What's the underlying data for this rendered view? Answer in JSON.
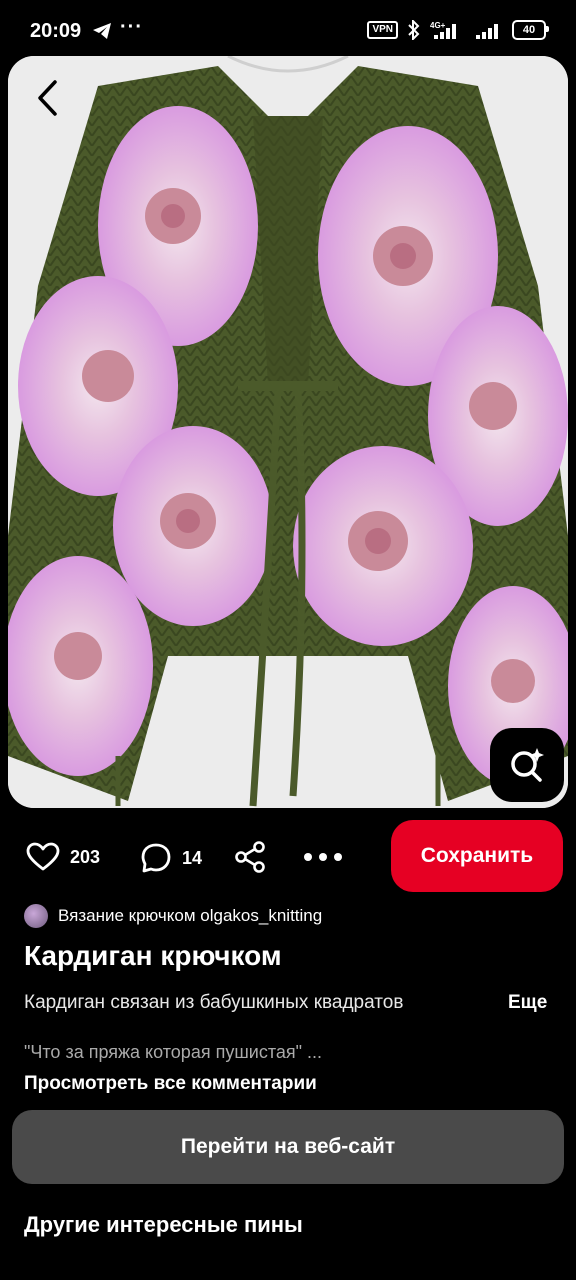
{
  "status_bar": {
    "time": "20:09",
    "dots": "···",
    "vpn": "VPN",
    "battery": "40",
    "icons": [
      "telegram-icon",
      "bluetooth-icon",
      "signal-4g-icon",
      "signal-icon",
      "battery-icon"
    ]
  },
  "image": {
    "description_icons": [
      "back-arrow-icon",
      "visual-search-icon"
    ]
  },
  "actions": {
    "likes": "203",
    "comments": "14",
    "save_label": "Сохранить",
    "icons": [
      "heart-icon",
      "comment-icon",
      "share-icon",
      "more-icon"
    ]
  },
  "pin": {
    "author": "Вязание крючком olgakos_knitting",
    "title": "Кардиган крючком",
    "description": "Кардиган связан из бабушкиных квадратов",
    "more_label": "Еще",
    "comment_preview": "\"Что за пряжа которая пушистая\" ...",
    "view_all_comments": "Просмотреть все комментарии",
    "website_button": "Перейти на веб-сайт",
    "more_pins_heading": "Другие интересные пины"
  },
  "colors": {
    "save_button": "#e60023",
    "background": "#000000",
    "cardigan_green": "#4b5a2a",
    "fur_pink": "#e3b8e6"
  }
}
